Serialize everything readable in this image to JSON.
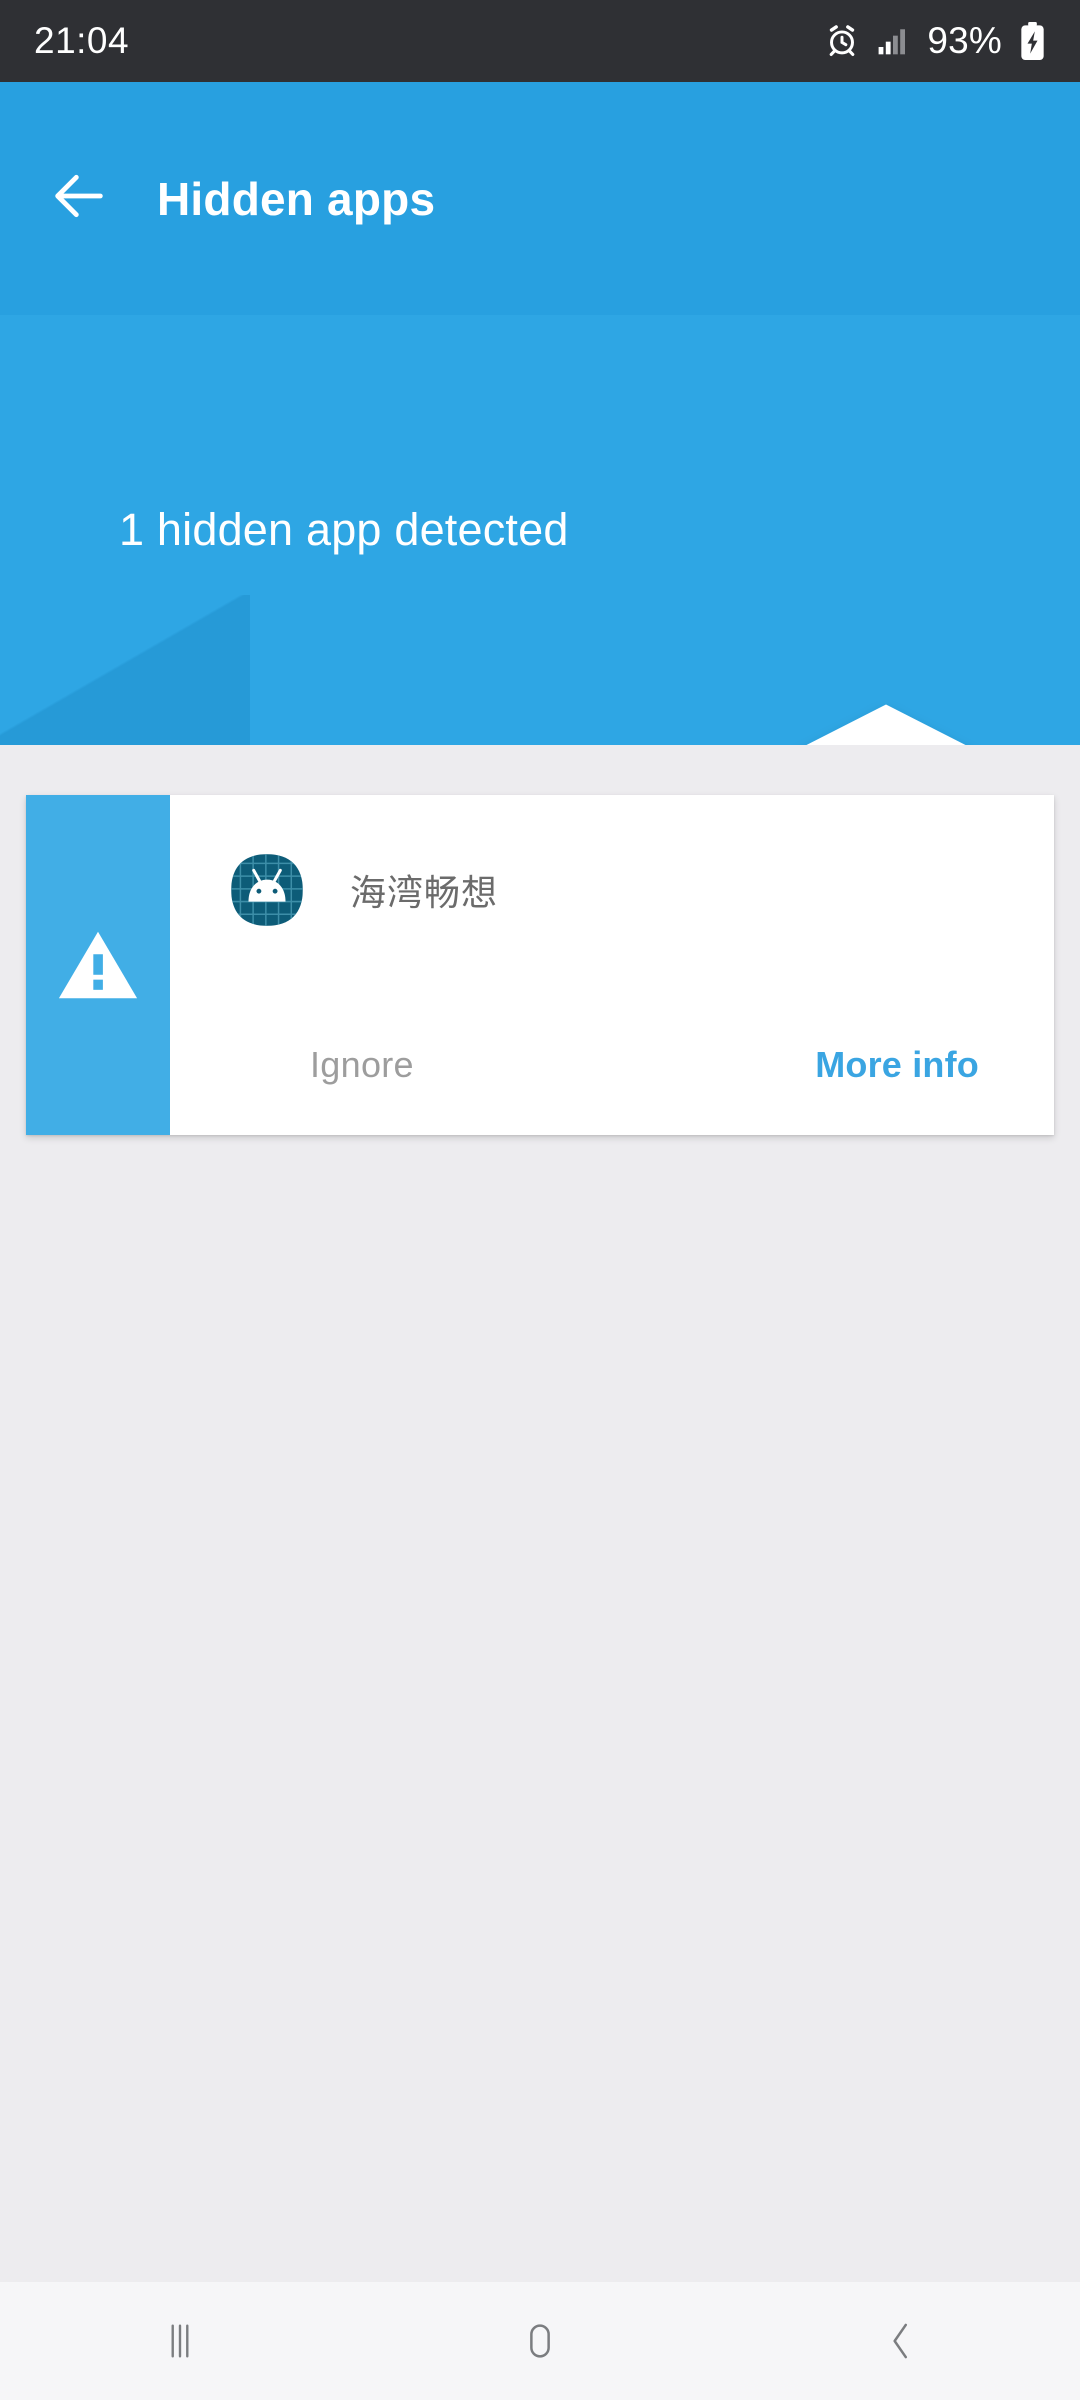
{
  "status_bar": {
    "clock": "21:04",
    "battery_percent": "93%",
    "icons": [
      "alarm-icon",
      "signal-bars-icon",
      "battery-charging-icon"
    ],
    "background_color": "#2f3034",
    "text_color": "#ffffff"
  },
  "app_bar": {
    "title": "Hidden apps",
    "back_icon": "arrow-left-icon",
    "background_color": "#28a0e0"
  },
  "hero": {
    "message": "1 hidden app detected",
    "icon": "shield-alert-icon",
    "background_color": "#2ea6e4"
  },
  "card": {
    "warning_icon": "warning-triangle-icon",
    "app_icon": "android-grid-app-icon",
    "app_name": "海湾畅想",
    "ignore_label": "Ignore",
    "more_info_label": "More info",
    "strip_color": "#41aee6",
    "more_info_color": "#3aa5e2",
    "ignore_color": "#9d9d9d"
  },
  "nav_bar": {
    "recents_icon": "recents-icon",
    "home_icon": "home-icon",
    "back_icon": "back-chevron-icon",
    "background_color": "#f6f6f8"
  },
  "page": {
    "background_color": "#edecef"
  }
}
